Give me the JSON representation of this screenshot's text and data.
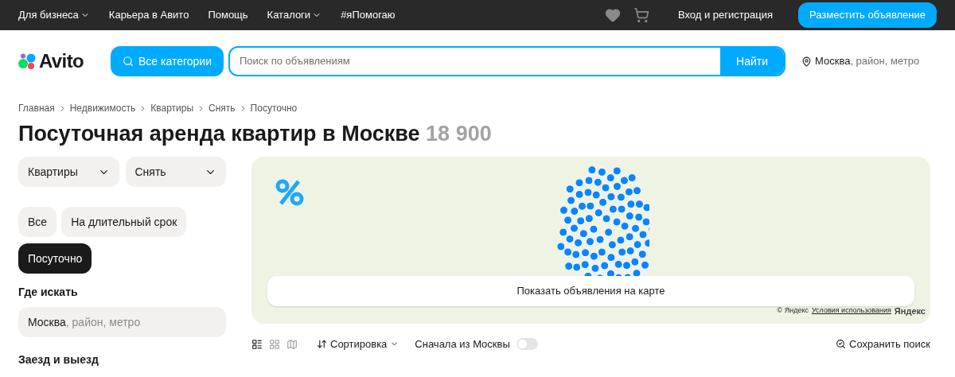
{
  "top_nav": {
    "links": [
      {
        "label": "Для бизнеса",
        "dropdown": true
      },
      {
        "label": "Карьера в Авито",
        "dropdown": false
      },
      {
        "label": "Помощь",
        "dropdown": false
      },
      {
        "label": "Каталоги",
        "dropdown": true
      },
      {
        "label": "#яПомогаю",
        "dropdown": false
      }
    ],
    "login": "Вход и регистрация",
    "post_button": "Разместить объявление"
  },
  "header": {
    "logo": "Avito",
    "categories_button": "Все категории",
    "search": {
      "placeholder": "Поиск по объявлениям"
    },
    "search_button": "Найти",
    "location": {
      "city": "Москва",
      "rest": ", район, метро"
    }
  },
  "breadcrumbs": [
    "Главная",
    "Недвижимость",
    "Квартиры",
    "Снять",
    "Посуточно"
  ],
  "title": {
    "text": "Посуточная аренда квартир в Москве",
    "count": "18 900"
  },
  "filters": {
    "dropdowns": [
      "Квартиры",
      "Снять"
    ],
    "chips": [
      {
        "label": "Все",
        "selected": false
      },
      {
        "label": "На длительный срок",
        "selected": false
      },
      {
        "label": "Посуточно",
        "selected": true
      }
    ],
    "where_heading": "Где искать",
    "where_field": {
      "city": "Москва",
      "rest": ", район, метро"
    },
    "dates_heading": "Заезд и выезд"
  },
  "map": {
    "show_button": "Показать объявления на карте",
    "attribution": "© Яндекс",
    "terms_link": "Условия использования",
    "brand": "Яндекс"
  },
  "toolbar": {
    "views": [
      {
        "kind": "list",
        "selected": true
      },
      {
        "kind": "grid",
        "selected": false
      },
      {
        "kind": "map",
        "selected": false
      }
    ],
    "sort": "Сортировка",
    "moscow_first": {
      "label": "Сначала из Москвы",
      "on": false
    },
    "save_search": "Сохранить поиск"
  }
}
